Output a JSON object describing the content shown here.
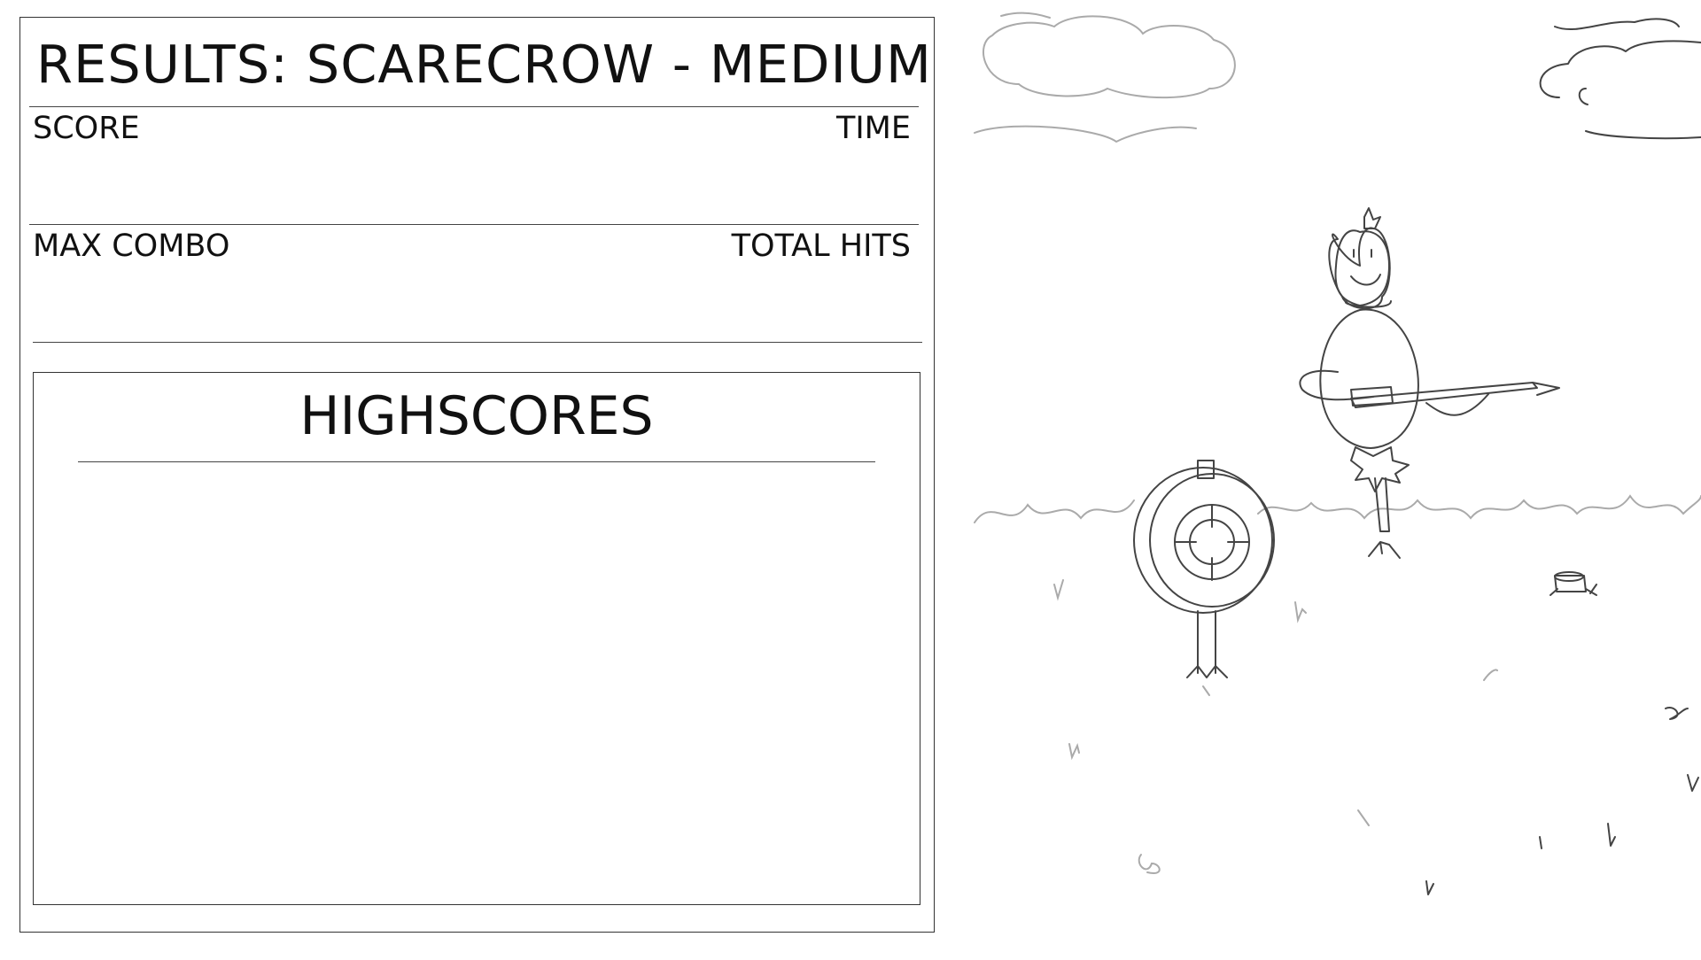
{
  "results": {
    "title": "RESULTS: SCARECROW - MEDIUM",
    "score_label": "SCORE",
    "time_label": "TIME",
    "max_combo_label": "MAX COMBO",
    "total_hits_label": "TOTAL HITS"
  },
  "highscores": {
    "title": "HIGHSCORES"
  }
}
